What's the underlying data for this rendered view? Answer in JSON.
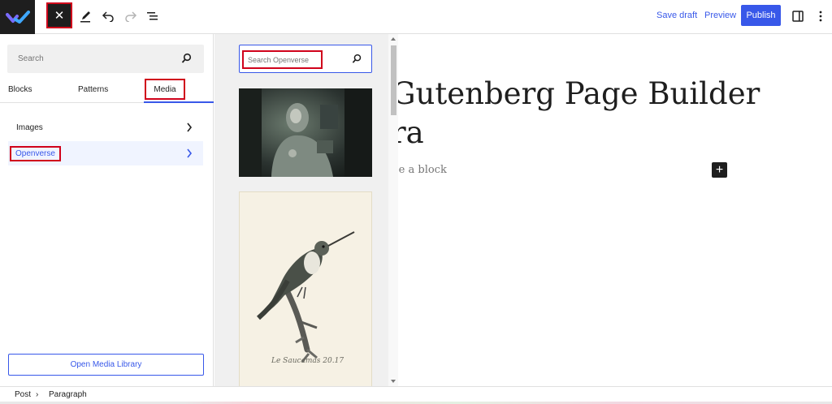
{
  "toolbar": {
    "close_glyph": "✕",
    "save_draft": "Save draft",
    "preview": "Preview",
    "publish": "Publish"
  },
  "inserter": {
    "search_placeholder": "Search",
    "tabs": {
      "blocks": "Blocks",
      "patterns": "Patterns",
      "media": "Media"
    },
    "categories": {
      "images": "Images",
      "openverse": "Openverse"
    },
    "open_media_library": "Open Media Library"
  },
  "openverse": {
    "search_placeholder": "Search Openverse",
    "thumb2_caption": "Le Saucamas 20.17"
  },
  "canvas": {
    "title_line1": "Gutenberg Page Builder",
    "title_line2": "ra",
    "block_placeholder": "se a block",
    "add_block_glyph": "+"
  },
  "footer": {
    "crumb_post": "Post",
    "crumb_separator": "›",
    "crumb_paragraph": "Paragraph"
  },
  "colors": {
    "accent": "#3858e9",
    "highlight": "#d0021b",
    "dark": "#1e1e1e"
  }
}
